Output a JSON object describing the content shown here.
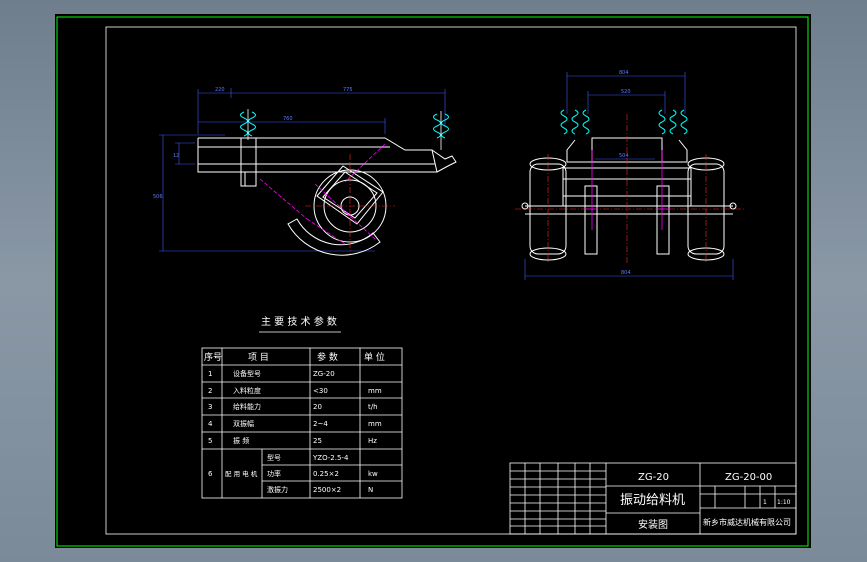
{
  "params_title": "主 要 技 术 参 数",
  "table": {
    "headers": [
      "序号",
      "项 目",
      "参 数",
      "单 位"
    ],
    "rows": [
      {
        "no": "1",
        "item": "设备型号",
        "value": "ZG-20",
        "unit": ""
      },
      {
        "no": "2",
        "item": "入料粒度",
        "value": "<30",
        "unit": "mm"
      },
      {
        "no": "3",
        "item": "给料能力",
        "value": "20",
        "unit": "t/h"
      },
      {
        "no": "4",
        "item": "双振幅",
        "value": "2~4",
        "unit": "mm"
      },
      {
        "no": "5",
        "item": "振 频",
        "value": "25",
        "unit": "Hz"
      }
    ],
    "motor": {
      "no": "6",
      "label": "配 用 电 机",
      "rows": [
        {
          "item": "型号",
          "value": "YZO-2.5-4",
          "unit": ""
        },
        {
          "item": "功率",
          "value": "0.25×2",
          "unit": "kw"
        },
        {
          "item": "激振力",
          "value": "2500×2",
          "unit": "N"
        }
      ]
    }
  },
  "title_block": {
    "model": "ZG-20",
    "drawing_no": "ZG-20-00",
    "name": "振动给料机",
    "view": "安装图",
    "company": "新乡市威达机械有限公司",
    "scale": "1:10",
    "sheet": "1"
  },
  "dimensions": {
    "side_top_left": "220",
    "side_top_right": "775",
    "side_inner": "760",
    "side_height_small": "12",
    "side_height_total": "506",
    "front_top": "804",
    "front_inner": "520",
    "front_mid": "504",
    "front_bottom": "804"
  },
  "colors": {
    "background": "#000000",
    "frame_outer": "#00ff00",
    "frame_inner": "#ffffff",
    "machine": "#ffffff",
    "dimensions": "#3b5bff",
    "hidden_lines": "#ff00ff",
    "centerlines": "#ff2020",
    "springs": "#00ffff"
  }
}
